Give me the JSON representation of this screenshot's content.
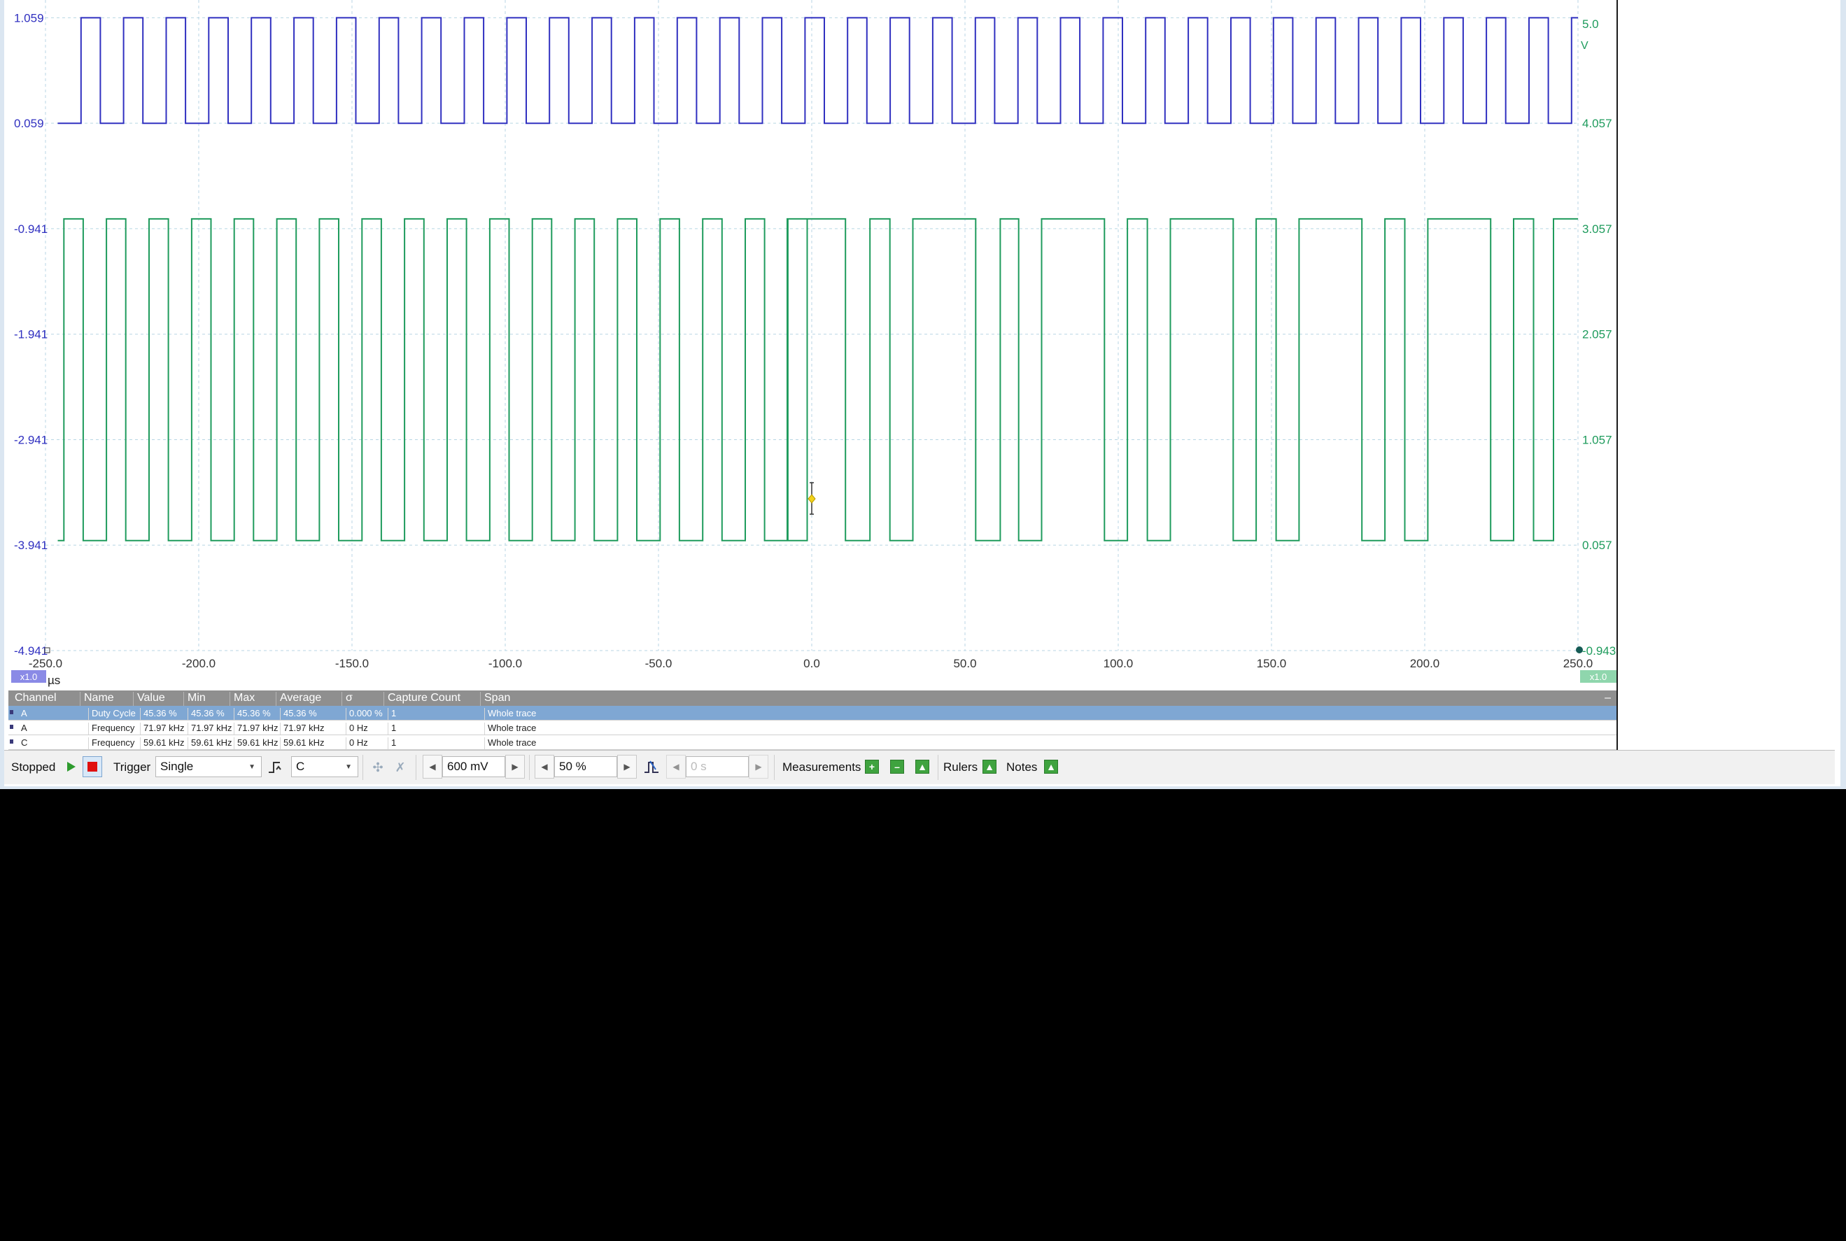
{
  "axes": {
    "left_ticks": [
      "1.059",
      "0.059",
      "-0.941",
      "-1.941",
      "-2.941",
      "-3.941",
      "-4.941"
    ],
    "right_unit": "V",
    "right_ticks": [
      "5.0",
      "4.057",
      "3.057",
      "2.057",
      "1.057",
      "0.057",
      "-0.943"
    ],
    "x_ticks": [
      "-250.0",
      "-200.0",
      "-150.0",
      "-100.0",
      "-50.0",
      "0.0",
      "50.0",
      "100.0",
      "150.0",
      "200.0",
      "250.0"
    ],
    "x_unit": "µs",
    "left_zoom_badge": "x1.0",
    "right_zoom_badge": "x1.0",
    "colors": {
      "channel_a": "#3030c0",
      "channel_c": "#1e9b5c",
      "grid": "#b8d6e4"
    }
  },
  "chart_data": {
    "type": "line",
    "x_range": [
      -250,
      250
    ],
    "series": [
      {
        "name": "A",
        "color": "#3030c0",
        "ylim_volts": [
          -4.941,
          1.559
        ],
        "high": 1.059,
        "low": 0.059,
        "frequency_khz": 71.97,
        "duty_cycle_percent": 45.36,
        "start_us": -246.0
      },
      {
        "name": "C",
        "color": "#1e9b5c",
        "ylim_volts": [
          -0.943,
          5.557
        ],
        "high": 3.15,
        "low": 0.1,
        "pattern_segments": [
          {
            "x_from": -246.0,
            "x_to": -3.0,
            "frequency_khz": 71.97,
            "duty_pct": 45.36
          },
          {
            "x_from": -8.0,
            "x_to": 250.0,
            "pulses": [
              {
                "rise": -8.0,
                "fall": 11.0
              },
              {
                "rise": 19.0,
                "fall": 25.5
              },
              {
                "rise": 33.0,
                "fall": 53.5
              },
              {
                "rise": 61.5,
                "fall": 67.5
              },
              {
                "rise": 75.0,
                "fall": 95.5
              },
              {
                "rise": 103.0,
                "fall": 109.5
              },
              {
                "rise": 117.0,
                "fall": 137.5
              },
              {
                "rise": 145.0,
                "fall": 151.5
              },
              {
                "rise": 159.0,
                "fall": 179.5
              },
              {
                "rise": 187.0,
                "fall": 193.5
              },
              {
                "rise": 201.0,
                "fall": 221.5
              },
              {
                "rise": 229.0,
                "fall": 235.5
              },
              {
                "rise": 242.0,
                "fall": 250.0
              }
            ]
          }
        ]
      }
    ]
  },
  "measurements": {
    "headers": [
      "Channel",
      "Name",
      "Value",
      "Min",
      "Max",
      "Average",
      "σ",
      "Capture Count",
      "Span"
    ],
    "collapse_symbol": "–",
    "rows": [
      {
        "channel": "A",
        "name": "Duty Cycle",
        "value": "45.36 %",
        "min": "45.36 %",
        "max": "45.36 %",
        "average": "45.36 %",
        "sigma": "0.000 %",
        "count": "1",
        "span": "Whole trace"
      },
      {
        "channel": "A",
        "name": "Frequency",
        "value": "71.97 kHz",
        "min": "71.97 kHz",
        "max": "71.97 kHz",
        "average": "71.97 kHz",
        "sigma": "0 Hz",
        "count": "1",
        "span": "Whole trace"
      },
      {
        "channel": "C",
        "name": "Frequency",
        "value": "59.61 kHz",
        "min": "59.61 kHz",
        "max": "59.61 kHz",
        "average": "59.61 kHz",
        "sigma": "0 Hz",
        "count": "1",
        "span": "Whole trace"
      }
    ]
  },
  "toolbar": {
    "status": "Stopped",
    "trigger_label": "Trigger",
    "trigger_mode": "Single",
    "trigger_source": "C",
    "threshold": "600 mV",
    "pretrigger": "50 %",
    "delay": "0 s",
    "measurements_label": "Measurements",
    "rulers_label": "Rulers",
    "notes_label": "Notes"
  }
}
